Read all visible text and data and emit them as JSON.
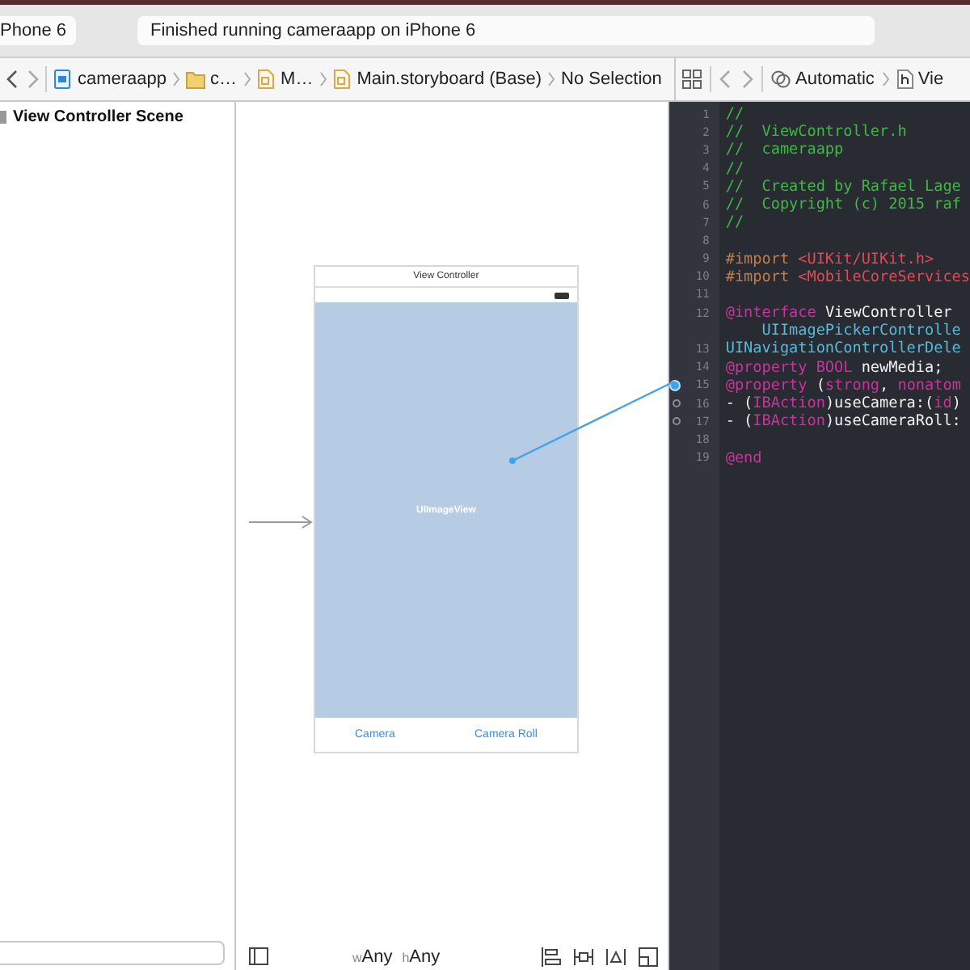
{
  "toolbar": {
    "scheme": "Phone 6",
    "activity": "Finished running cameraapp on iPhone 6"
  },
  "jump_bar": {
    "crumbs": [
      {
        "text": "cameraapp",
        "kind": "project"
      },
      {
        "text": "c…",
        "kind": "folder"
      },
      {
        "text": "M…",
        "kind": "storyboard"
      },
      {
        "text": "Main.storyboard (Base)",
        "kind": "storyboard"
      },
      {
        "text": "No Selection",
        "kind": "none"
      }
    ]
  },
  "outline": {
    "items": [
      {
        "label": "View Controller Scene"
      }
    ]
  },
  "canvas": {
    "scene": {
      "title": "View Controller",
      "image_view": "UIImageView",
      "toolbar_items": [
        "Camera",
        "Camera Roll"
      ]
    },
    "size_class": [
      {
        "prefix": "w",
        "value": "Any"
      },
      {
        "prefix": "h",
        "value": "Any"
      }
    ]
  },
  "assistant": {
    "mode": "Automatic",
    "file": "Vie"
  },
  "code": {
    "lines": [
      {
        "number": "1",
        "tokens": [
          {
            "kind": "comment",
            "text": "//"
          }
        ]
      },
      {
        "number": "2",
        "tokens": [
          {
            "kind": "comment",
            "text": "//  ViewController.h"
          }
        ]
      },
      {
        "number": "3",
        "tokens": [
          {
            "kind": "comment",
            "text": "//  cameraapp"
          }
        ]
      },
      {
        "number": "4",
        "tokens": [
          {
            "kind": "comment",
            "text": "//"
          }
        ]
      },
      {
        "number": "5",
        "tokens": [
          {
            "kind": "comment",
            "text": "//  Created by Rafael Lage"
          }
        ]
      },
      {
        "number": "6",
        "tokens": [
          {
            "kind": "comment",
            "text": "//  Copyright (c) 2015 raf"
          }
        ]
      },
      {
        "number": "7",
        "tokens": [
          {
            "kind": "comment",
            "text": "//"
          }
        ]
      },
      {
        "number": "8"
      },
      {
        "number": "9",
        "tokens": [
          {
            "kind": "preproc",
            "text": "#import "
          },
          {
            "kind": "string",
            "text": "<UIKit/UIKit.h>"
          }
        ]
      },
      {
        "number": "10",
        "tokens": [
          {
            "kind": "preproc",
            "text": "#import "
          },
          {
            "kind": "string",
            "text": "<MobileCoreServices"
          }
        ]
      },
      {
        "number": "11"
      },
      {
        "number": "12",
        "tokens": [
          {
            "kind": "keyword",
            "text": "@interface"
          },
          {
            "kind": "plain",
            "text": " ViewController"
          }
        ]
      },
      {
        "tokens": [
          {
            "kind": "type",
            "text": "    UIImagePickerControlle"
          }
        ]
      },
      {
        "number": "13",
        "tokens": [
          {
            "kind": "type",
            "text": "UINavigationControllerDele"
          }
        ]
      },
      {
        "number": "14",
        "tokens": [
          {
            "kind": "keyword",
            "text": "@property"
          },
          {
            "kind": "keyword",
            "text": " BOOL"
          },
          {
            "kind": "plain",
            "text": " newMedia;"
          }
        ]
      },
      {
        "number": "15",
        "connected": true,
        "tokens": [
          {
            "kind": "keyword",
            "text": "@property"
          },
          {
            "kind": "plain",
            "text": " ("
          },
          {
            "kind": "keyword",
            "text": "strong"
          },
          {
            "kind": "plain",
            "text": ", "
          },
          {
            "kind": "keyword",
            "text": "nonatom"
          }
        ]
      },
      {
        "number": "16",
        "connected": false,
        "tokens": [
          {
            "kind": "plain",
            "text": "- ("
          },
          {
            "kind": "keyword",
            "text": "IBAction"
          },
          {
            "kind": "plain",
            "text": ")useCamera:("
          },
          {
            "kind": "keyword",
            "text": "id"
          },
          {
            "kind": "plain",
            "text": ")"
          }
        ]
      },
      {
        "number": "17",
        "connected": false,
        "tokens": [
          {
            "kind": "plain",
            "text": "- ("
          },
          {
            "kind": "keyword",
            "text": "IBAction"
          },
          {
            "kind": "plain",
            "text": ")useCameraRoll:"
          }
        ]
      },
      {
        "number": "18"
      },
      {
        "number": "19",
        "tokens": [
          {
            "kind": "keyword",
            "text": "@end"
          }
        ]
      }
    ]
  }
}
